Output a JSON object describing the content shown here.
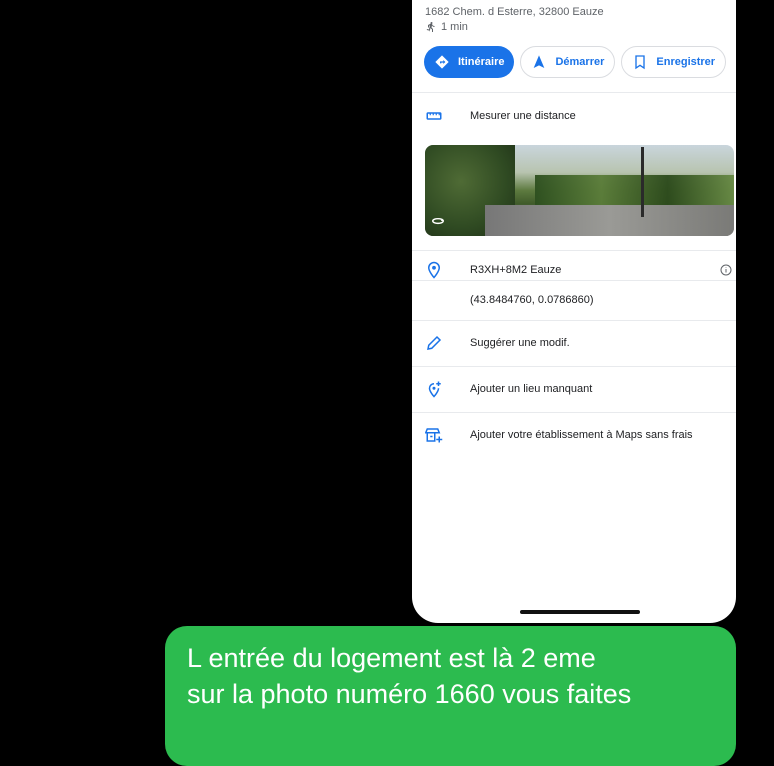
{
  "place": {
    "address": "1682 Chem. d Esterre, 32800 Eauze",
    "walk_time": "1 min"
  },
  "actions": [
    {
      "label": "Itinéraire",
      "icon": "directions-icon"
    },
    {
      "label": "Démarrer",
      "icon": "navigation-arrow-icon"
    },
    {
      "label": "Enregistrer",
      "icon": "bookmark-icon"
    }
  ],
  "rows": {
    "measure": "Mesurer une distance",
    "plus_code": "R3XH+8M2 Eauze",
    "coordinates": "(43.8484760, 0.0786860)",
    "suggest_edit": "Suggérer une modif.",
    "add_missing_place": "Ajouter un lieu manquant",
    "add_business": "Ajouter votre établissement à Maps sans frais"
  },
  "message": {
    "line1": "L entrée du logement est là 2 eme",
    "line2": "sur la photo numéro 1660 vous faites"
  },
  "colors": {
    "accent": "#1a73e8",
    "bubble": "#2cbb4f",
    "background": "#000000"
  }
}
